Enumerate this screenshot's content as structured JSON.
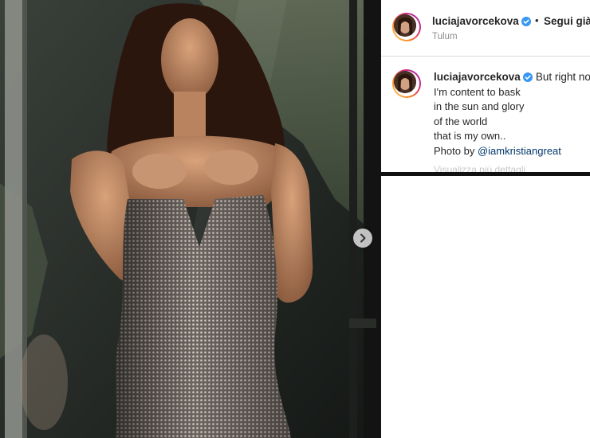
{
  "post": {
    "username": "luciajavorcekova",
    "separator": "•",
    "follow_label": "Segui già",
    "location": "Tulum"
  },
  "caption": {
    "username": "luciajavorcekova",
    "first_line": "But right now",
    "lines": [
      "I'm content to bask",
      "in the sun and glory",
      "of the world",
      "that is my own.."
    ],
    "credit_prefix": "Photo by ",
    "credit_mention": "@iamkristiangreat",
    "faded_text": "Visualizza più dettagli"
  },
  "colors": {
    "verified_badge": "#3897f0",
    "text": "#262626",
    "muted": "#8e8e8e",
    "mention": "#00376b"
  },
  "icons": {
    "next": "chevron-right-icon",
    "verified": "verified-badge-icon"
  }
}
